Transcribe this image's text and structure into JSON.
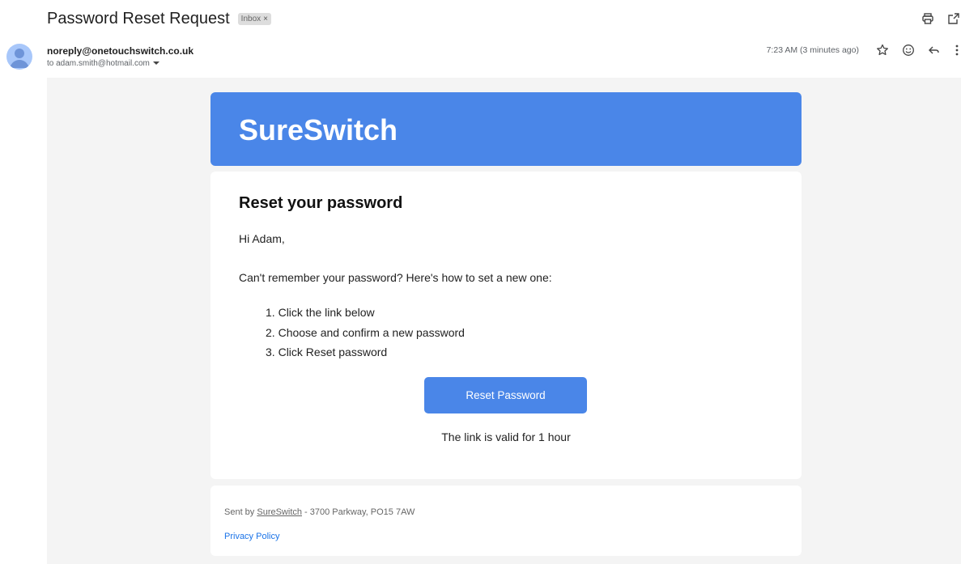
{
  "email": {
    "subject": "Password Reset Request",
    "label": "Inbox",
    "label_remove": "×",
    "sender": "noreply@onetouchswitch.co.uk",
    "recipient": "to adam.smith@hotmail.com",
    "timestamp": "7:23 AM (3 minutes ago)"
  },
  "icons": {
    "print": "print-icon",
    "open_new_window": "open-in-new-window-icon",
    "star": "star-icon",
    "emoji": "emoji-icon",
    "reply": "reply-icon",
    "more": "more-vert-icon",
    "dropdown": "chevron-down-icon"
  },
  "body": {
    "brand": "SureSwitch",
    "title": "Reset your password",
    "greeting": "Hi Adam,",
    "intro": "Can't remember your password? Here's how to set a new one:",
    "steps": [
      {
        "num": "1.",
        "text": "Click the link below"
      },
      {
        "num": "2.",
        "text": "Choose and confirm a new password"
      },
      {
        "num": "3.",
        "text": "Click Reset password"
      }
    ],
    "button_label": "Reset Password",
    "validity": "The link is valid for 1 hour"
  },
  "footer": {
    "sent_by_prefix": "Sent by ",
    "sent_by_link": "SureSwitch",
    "sent_by_suffix": " - 3700 Parkway, PO15 7AW",
    "privacy_link": "Privacy Policy"
  },
  "colors": {
    "brand_blue": "#4a86e8",
    "body_background": "#f4f4f4",
    "link_blue": "#1a73e8"
  }
}
